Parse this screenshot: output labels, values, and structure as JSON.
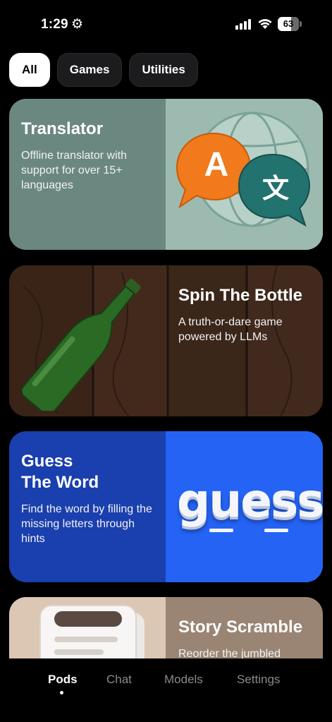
{
  "status_bar": {
    "time": "1:29",
    "battery_level": "63"
  },
  "filters": [
    {
      "label": "All",
      "active": true
    },
    {
      "label": "Games",
      "active": false
    },
    {
      "label": "Utilities",
      "active": false
    }
  ],
  "cards": {
    "translator": {
      "title": "Translator",
      "description": "Offline translator with support for over 15+ languages",
      "bubble_a": "A",
      "bubble_b": "文"
    },
    "bottle": {
      "title": "Spin The Bottle",
      "description": "A truth-or-dare game powered by LLMs"
    },
    "guess": {
      "title_line1": "Guess",
      "title_line2": "The Word",
      "description": "Find the word by filling the missing letters through hints",
      "art_text": "guess"
    },
    "story": {
      "title": "Story Scramble",
      "description": "Reorder the jumbled"
    }
  },
  "tabbar": {
    "tabs": [
      {
        "label": "Pods",
        "active": true
      },
      {
        "label": "Chat",
        "active": false
      },
      {
        "label": "Models",
        "active": false
      },
      {
        "label": "Settings",
        "active": false
      }
    ]
  },
  "colors": {
    "background": "#000000",
    "chip_inactive": "#1c1c1e",
    "translator_card": "#6b8880",
    "guess_card": "#1a3fae",
    "guess_art": "#2563f5"
  }
}
